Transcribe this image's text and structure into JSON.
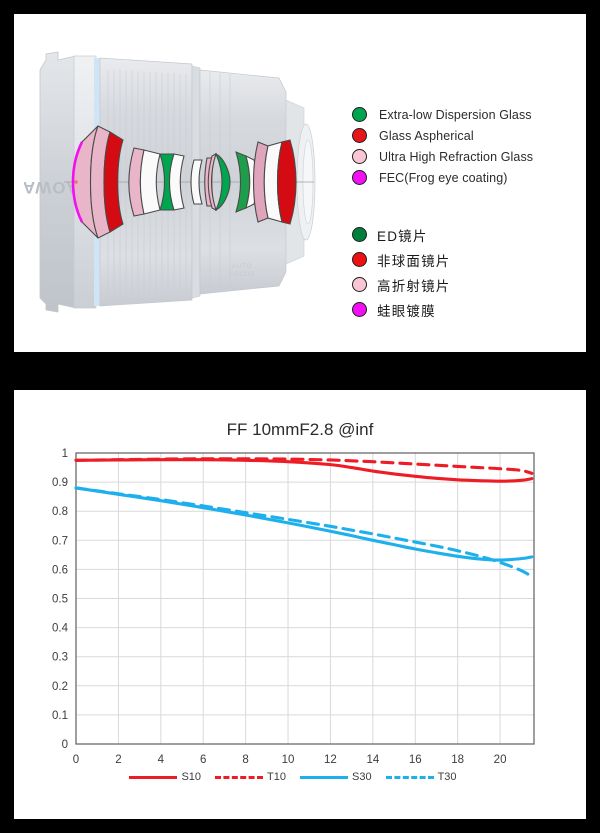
{
  "page": {
    "background_color": "#000000",
    "panel_color": "#ffffff"
  },
  "lens_panel": {
    "name": "lens-construction-diagram",
    "brand_text": "LAOWA",
    "sub_text": "AUTO FOCUS",
    "legend_en": {
      "title": "",
      "items": [
        {
          "color": "#00a64f",
          "label": "Extra-low Dispersion Glass",
          "icon": "green-dot-icon"
        },
        {
          "color": "#e8151d",
          "label": "Glass Aspherical",
          "icon": "red-dot-icon"
        },
        {
          "color": "#f8c6d4",
          "label": "Ultra High Refraction Glass",
          "icon": "pink-dot-icon"
        },
        {
          "color": "#f210f2",
          "label": "FEC(Frog eye coating)",
          "icon": "magenta-dot-icon"
        }
      ]
    },
    "legend_zh": {
      "items": [
        {
          "color": "#00803c",
          "label": "ED镜片",
          "icon": "green-dot-icon"
        },
        {
          "color": "#ee1111",
          "label": "非球面镜片",
          "icon": "red-dot-icon"
        },
        {
          "color": "#f8c6d4",
          "label": "高折射镜片",
          "icon": "pink-dot-icon"
        },
        {
          "color": "#f210f2",
          "label": "蛙眼镀膜",
          "icon": "magenta-dot-icon"
        }
      ]
    }
  },
  "chart_panel": {
    "title": "FF 10mmF2.8 @inf"
  },
  "chart_data": {
    "type": "line",
    "title": "FF 10mmF2.8 @inf",
    "xlabel": "",
    "ylabel": "",
    "xlim": [
      0,
      21.6
    ],
    "ylim": [
      0,
      1
    ],
    "grid": true,
    "legend_position": "bottom",
    "xticks": [
      0,
      2,
      4,
      6,
      8,
      10,
      12,
      14,
      16,
      18,
      20
    ],
    "xtick_labels": [
      "0",
      "2",
      "4",
      "6",
      "8",
      "10",
      "12",
      "14",
      "16",
      "18",
      "20"
    ],
    "yticks": [
      0,
      0.1,
      0.2,
      0.3,
      0.4,
      0.5,
      0.6,
      0.7,
      0.8,
      0.9,
      1
    ],
    "ytick_labels": [
      "0",
      "0.1",
      "0.2",
      "0.3",
      "0.4",
      "0.5",
      "0.6",
      "0.7",
      "0.8",
      "0.9",
      "1"
    ],
    "series": [
      {
        "name": "S10",
        "color": "#ee1c25",
        "style": "solid",
        "x": [
          0,
          2,
          4,
          6,
          8,
          10,
          12,
          13,
          14,
          15,
          16,
          17,
          18,
          19,
          20,
          21,
          21.5
        ],
        "values": [
          0.975,
          0.976,
          0.977,
          0.977,
          0.975,
          0.97,
          0.96,
          0.95,
          0.938,
          0.928,
          0.92,
          0.913,
          0.908,
          0.905,
          0.903,
          0.906,
          0.912
        ]
      },
      {
        "name": "T10",
        "color": "#ee1c25",
        "style": "dashed",
        "x": [
          0,
          2,
          4,
          6,
          8,
          10,
          12,
          13,
          14,
          15,
          16,
          17,
          18,
          19,
          20,
          21,
          21.5
        ],
        "values": [
          0.975,
          0.977,
          0.979,
          0.98,
          0.98,
          0.979,
          0.976,
          0.973,
          0.97,
          0.966,
          0.962,
          0.958,
          0.954,
          0.95,
          0.946,
          0.94,
          0.93
        ]
      },
      {
        "name": "S30",
        "color": "#1eb0ec",
        "style": "solid",
        "x": [
          0,
          2,
          4,
          6,
          8,
          10,
          12,
          13,
          14,
          15,
          16,
          17,
          18,
          19,
          20,
          21,
          21.5
        ],
        "values": [
          0.88,
          0.858,
          0.836,
          0.812,
          0.787,
          0.76,
          0.731,
          0.716,
          0.7,
          0.685,
          0.67,
          0.657,
          0.645,
          0.636,
          0.632,
          0.637,
          0.643
        ]
      },
      {
        "name": "T30",
        "color": "#1eb0ec",
        "style": "dashed",
        "x": [
          0,
          2,
          4,
          6,
          8,
          10,
          12,
          13,
          14,
          15,
          16,
          17,
          18,
          19,
          20,
          21,
          21.5
        ],
        "values": [
          0.88,
          0.86,
          0.84,
          0.818,
          0.795,
          0.772,
          0.748,
          0.735,
          0.722,
          0.708,
          0.694,
          0.68,
          0.664,
          0.646,
          0.624,
          0.596,
          0.575
        ]
      }
    ],
    "legend": [
      {
        "label": "S10",
        "color": "#ee1c25",
        "style": "solid"
      },
      {
        "label": "T10",
        "color": "#ee1c25",
        "style": "dashed"
      },
      {
        "label": "S30",
        "color": "#1eb0ec",
        "style": "solid"
      },
      {
        "label": "T30",
        "color": "#1eb0ec",
        "style": "dashed"
      }
    ]
  }
}
